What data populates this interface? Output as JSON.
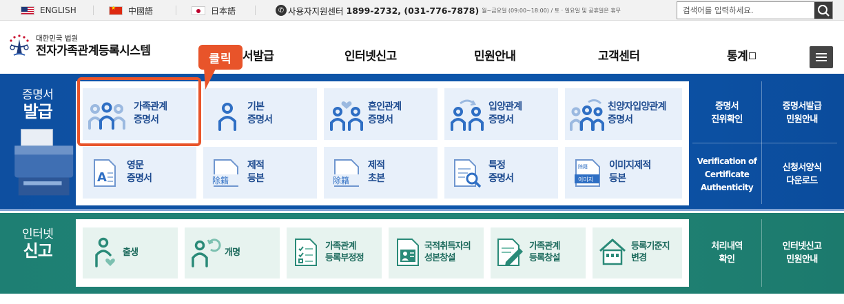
{
  "topbar": {
    "languages": [
      {
        "label": "ENGLISH",
        "icon": "us-flag-icon"
      },
      {
        "label": "中國語",
        "icon": "china-flag-icon"
      },
      {
        "label": "日本語",
        "icon": "japan-flag-icon"
      }
    ],
    "support_label": "사용자지원센터",
    "support_numbers": "1899-2732, (031-776-7878)",
    "support_hours": "월~금요일 (09:00~18:00) / 토 · 일요일 및 공휴일은 휴무",
    "search_placeholder": "검색어를 입력하세요."
  },
  "header": {
    "logo_small": "대한민국 법원",
    "logo_title": "전자가족관계등록시스템",
    "nav": [
      "증명서발급",
      "인터넷신고",
      "민원안내",
      "고객센터",
      "통계"
    ],
    "nav_partial_visible": "서발급"
  },
  "annotation": {
    "callout": "클릭",
    "color": "#e8542a"
  },
  "certificate_section": {
    "title_line1": "증명서",
    "title_line2": "발급",
    "tiles": [
      {
        "line1": "가족관계",
        "line2": "증명서",
        "icon": "family-icon"
      },
      {
        "line1": "기본",
        "line2": "증명서",
        "icon": "person-icon"
      },
      {
        "line1": "혼인관계",
        "line2": "증명서",
        "icon": "marriage-icon"
      },
      {
        "line1": "입양관계",
        "line2": "증명서",
        "icon": "adoption-icon"
      },
      {
        "line1": "친양자입양관계",
        "line2": "증명서",
        "icon": "full-adoption-icon"
      },
      {
        "line1": "영문",
        "line2": "증명서",
        "icon": "english-document-icon"
      },
      {
        "line1": "제적",
        "line2": "등본",
        "icon": "removed-register-icon"
      },
      {
        "line1": "제적",
        "line2": "초본",
        "icon": "removed-register-abstract-icon"
      },
      {
        "line1": "특정",
        "line2": "증명서",
        "icon": "search-document-icon"
      },
      {
        "line1": "이미지제적",
        "line2": "등본",
        "icon": "image-register-icon"
      }
    ],
    "side_links": [
      {
        "line1": "증명서",
        "line2": "진위확인"
      },
      {
        "line1": "증명서발급",
        "line2": "민원안내"
      },
      {
        "line1": "Verification of",
        "line2": "Certificate",
        "line3": "Authenticity"
      },
      {
        "line1": "신청서양식",
        "line2": "다운로드"
      }
    ],
    "colors": {
      "band": "#0d56ab",
      "tile": "#e8f0fa",
      "tile_text": "#1f4c90"
    }
  },
  "report_section": {
    "title_line1": "인터넷",
    "title_line2": "신고",
    "tiles": [
      {
        "line1": "출생",
        "line2": "",
        "icon": "birth-icon"
      },
      {
        "line1": "개명",
        "line2": "",
        "icon": "name-change-icon"
      },
      {
        "line1": "가족관계",
        "line2": "등록부정정",
        "icon": "checklist-document-icon"
      },
      {
        "line1": "국적취득자의",
        "line2": "성본창설",
        "icon": "id-card-icon"
      },
      {
        "line1": "가족관계",
        "line2": "등록창설",
        "icon": "pen-document-icon"
      },
      {
        "line1": "등록기준지",
        "line2": "변경",
        "icon": "house-icon"
      }
    ],
    "side_links": [
      {
        "line1": "처리내역",
        "line2": "확인"
      },
      {
        "line1": "인터넷신고",
        "line2": "민원안내"
      }
    ],
    "colors": {
      "band": "#228576",
      "tile": "#e7f3ef",
      "tile_text": "#1c6a5c"
    }
  }
}
